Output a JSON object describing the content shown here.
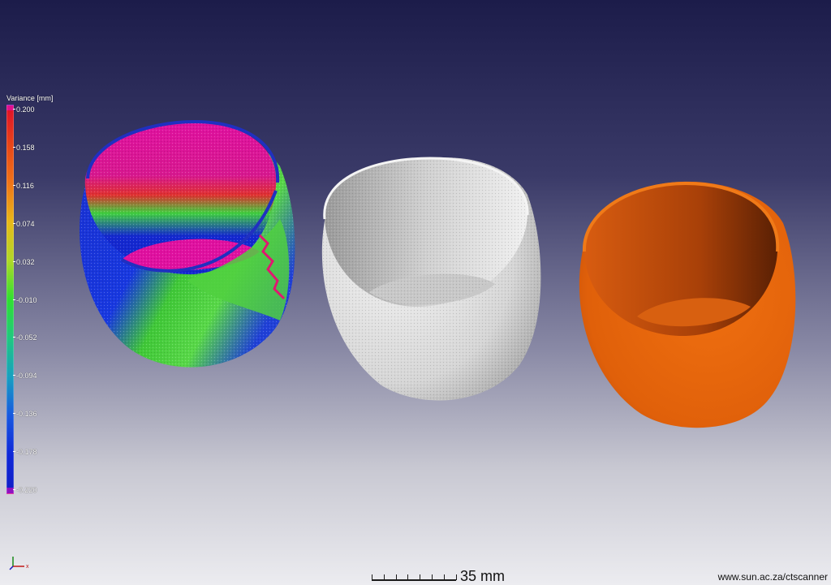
{
  "legend": {
    "title": "Variance [mm]",
    "labels": [
      "0.200",
      "0.158",
      "0.116",
      "0.074",
      "0.032",
      "-0.010",
      "-0.052",
      "-0.094",
      "-0.136",
      "-0.178",
      "-0.220"
    ]
  },
  "axes": {
    "x_label": "x"
  },
  "scale_bar": {
    "label": "35 mm"
  },
  "watermark": {
    "text": "www.sun.ac.za/ctscanner"
  },
  "colors": {
    "background_top": "#1c1c4a",
    "background_bottom": "#ececf0",
    "cad_model": "#e0600a",
    "scan_model": "#d8d8d8",
    "variance_high": "#e0108c",
    "variance_low": "#1020c8"
  }
}
